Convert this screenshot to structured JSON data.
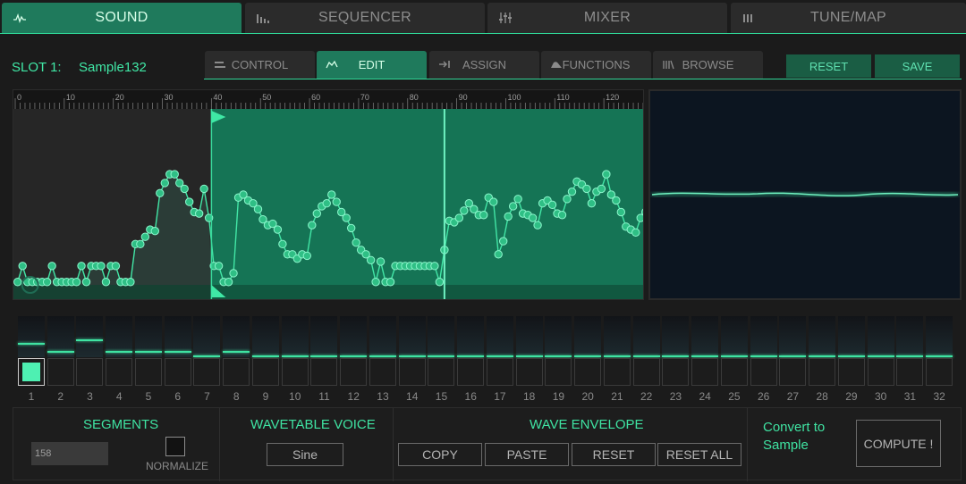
{
  "top_tabs": [
    "SOUND",
    "SEQUENCER",
    "MIXER",
    "TUNE/MAP"
  ],
  "active_top_tab": "SOUND",
  "slot": {
    "label": "SLOT 1:",
    "name": "Sample132"
  },
  "sub_tabs": [
    "CONTROL",
    "EDIT",
    "ASSIGN",
    "FUNCTIONS",
    "BROWSE"
  ],
  "active_sub_tab": "EDIT",
  "actions": {
    "reset": "RESET",
    "save": "SAVE"
  },
  "ruler": {
    "ticks": [
      "0",
      "10",
      "20",
      "30",
      "40",
      "50",
      "60",
      "70",
      "80",
      "90",
      "100",
      "110",
      "120"
    ]
  },
  "waveform": {
    "segments_total": 128,
    "loop_start": 40,
    "playhead": 87,
    "points": [
      0.02,
      0.13,
      0.02,
      0.02,
      0.02,
      0.02,
      0.02,
      0.13,
      0.02,
      0.02,
      0.02,
      0.02,
      0.02,
      0.13,
      0.02,
      0.13,
      0.13,
      0.13,
      0.02,
      0.13,
      0.13,
      0.02,
      0.02,
      0.02,
      0.28,
      0.28,
      0.33,
      0.38,
      0.37,
      0.63,
      0.7,
      0.76,
      0.76,
      0.7,
      0.66,
      0.57,
      0.5,
      0.49,
      0.66,
      0.46,
      0.13,
      0.13,
      0.02,
      0.02,
      0.08,
      0.6,
      0.62,
      0.58,
      0.56,
      0.52,
      0.45,
      0.41,
      0.42,
      0.38,
      0.28,
      0.21,
      0.21,
      0.18,
      0.21,
      0.2,
      0.41,
      0.49,
      0.54,
      0.56,
      0.62,
      0.57,
      0.5,
      0.46,
      0.39,
      0.29,
      0.24,
      0.21,
      0.17,
      0.02,
      0.16,
      0.02,
      0.02,
      0.13,
      0.13,
      0.13,
      0.13,
      0.13,
      0.13,
      0.13,
      0.13,
      0.13,
      0.02
    ],
    "tail_points": [
      0.24,
      0.44,
      0.43,
      0.46,
      0.51,
      0.56,
      0.52,
      0.48,
      0.48,
      0.6,
      0.57,
      0.21,
      0.3,
      0.47,
      0.54,
      0.59,
      0.49,
      0.48,
      0.46,
      0.41,
      0.56,
      0.58,
      0.55,
      0.49,
      0.48,
      0.59,
      0.64,
      0.71,
      0.69,
      0.66,
      0.56,
      0.64,
      0.66,
      0.76,
      0.62,
      0.58,
      0.5,
      0.4,
      0.38,
      0.36,
      0.46,
      0.5,
      0.45,
      0.42,
      0.4,
      0.41,
      0.38
    ]
  },
  "slot_strip": {
    "numbers": [
      "1",
      "2",
      "3",
      "4",
      "5",
      "6",
      "7",
      "8",
      "9",
      "10",
      "11",
      "12",
      "13",
      "14",
      "15",
      "16",
      "17",
      "18",
      "19",
      "20",
      "21",
      "22",
      "23",
      "24",
      "25",
      "26",
      "27",
      "28",
      "29",
      "30",
      "31",
      "32"
    ],
    "levels": [
      0.31,
      0.12,
      0.4,
      0.12,
      0.12,
      0.12,
      0.01,
      0.12,
      0.01,
      0.01,
      0.01,
      0.01,
      0.01,
      0.01,
      0.01,
      0.01,
      0.01,
      0.01,
      0.01,
      0.01,
      0.01,
      0.01,
      0.01,
      0.01,
      0.01,
      0.01,
      0.01,
      0.01,
      0.01,
      0.01,
      0.01,
      0.01
    ],
    "selected": 1
  },
  "segments": {
    "title": "SEGMENTS",
    "value": "158",
    "normalize_label": "NORMALIZE"
  },
  "wavetable_voice": {
    "title": "WAVETABLE VOICE",
    "value": "Sine"
  },
  "wave_envelope": {
    "title": "WAVE ENVELOPE",
    "buttons": [
      "COPY",
      "PASTE",
      "RESET",
      "RESET ALL"
    ]
  },
  "convert": {
    "label": "Convert to Sample",
    "button": "COMPUTE !"
  },
  "colors": {
    "accent": "#3fe3a2",
    "active_tab": "#1f7a5c",
    "panel": "#1d1d1d"
  }
}
